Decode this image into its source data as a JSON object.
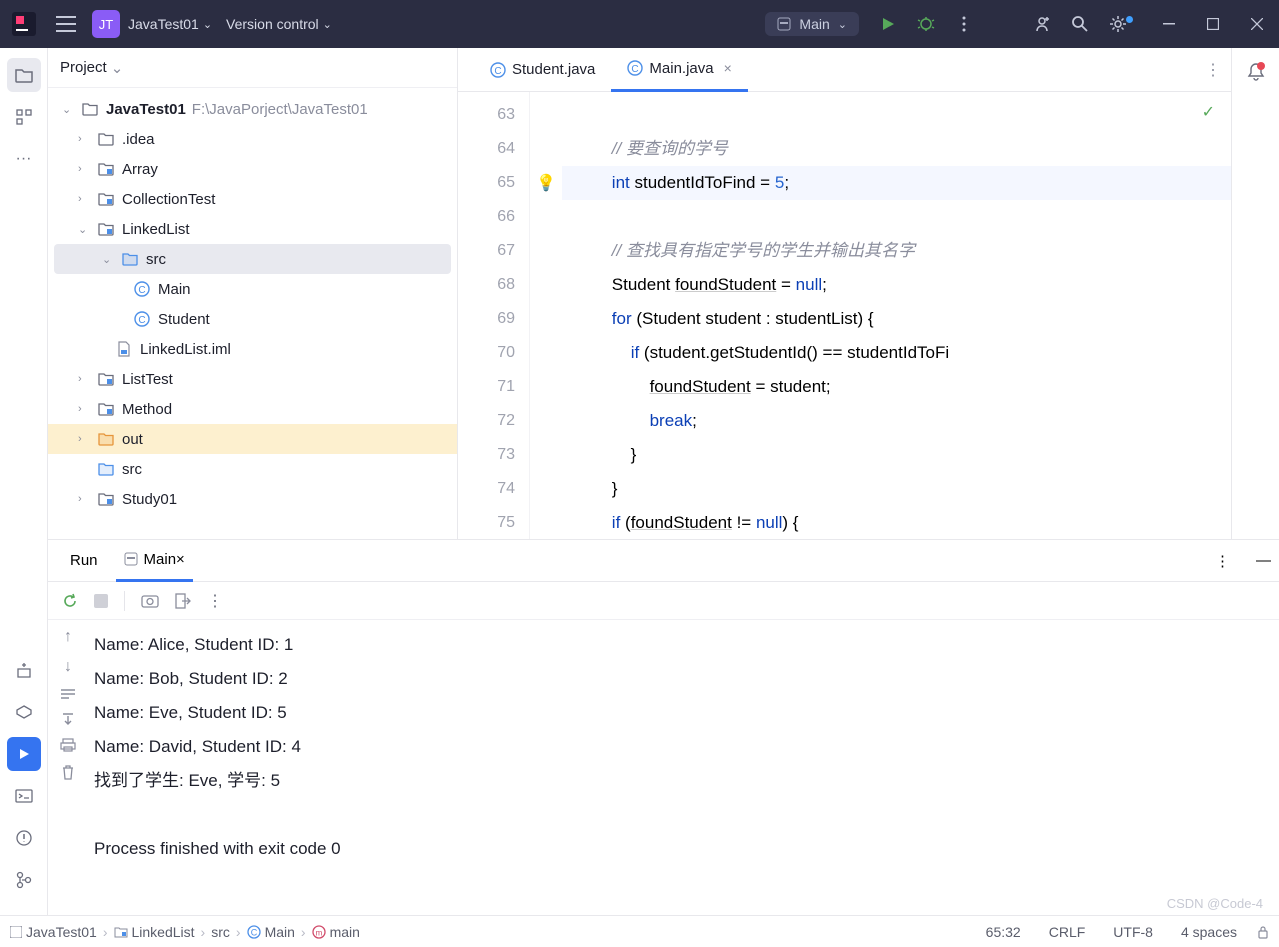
{
  "titlebar": {
    "project_initials": "JT",
    "project_name": "JavaTest01",
    "vcs_label": "Version control",
    "run_config": "Main"
  },
  "project_panel": {
    "title": "Project",
    "tree": [
      {
        "depth": 0,
        "arrow": "v",
        "icon": "folder",
        "label": "JavaTest01",
        "path": "F:\\JavaPorject\\JavaTest01"
      },
      {
        "depth": 1,
        "arrow": ">",
        "icon": "folder",
        "label": ".idea"
      },
      {
        "depth": 1,
        "arrow": ">",
        "icon": "module",
        "label": "Array"
      },
      {
        "depth": 1,
        "arrow": ">",
        "icon": "module",
        "label": "CollectionTest"
      },
      {
        "depth": 1,
        "arrow": "v",
        "icon": "module",
        "label": "LinkedList"
      },
      {
        "depth": 2,
        "arrow": "v",
        "icon": "src-folder",
        "label": "src",
        "selected": true
      },
      {
        "depth": 3,
        "arrow": "",
        "icon": "class",
        "label": "Main"
      },
      {
        "depth": 3,
        "arrow": "",
        "icon": "class",
        "label": "Student"
      },
      {
        "depth": 2,
        "arrow": "",
        "icon": "iml",
        "label": "LinkedList.iml"
      },
      {
        "depth": 1,
        "arrow": ">",
        "icon": "module",
        "label": "ListTest"
      },
      {
        "depth": 1,
        "arrow": ">",
        "icon": "module",
        "label": "Method"
      },
      {
        "depth": 1,
        "arrow": ">",
        "icon": "out-folder",
        "label": "out",
        "highlight": true
      },
      {
        "depth": 1,
        "arrow": "",
        "icon": "src-folder",
        "label": "src"
      },
      {
        "depth": 1,
        "arrow": ">",
        "icon": "module",
        "label": "Study01"
      }
    ]
  },
  "editor": {
    "tabs": [
      {
        "label": "Student.java",
        "active": false
      },
      {
        "label": "Main.java",
        "active": true
      }
    ],
    "line_start": 63,
    "highlighted_line": 65,
    "lines": [
      {
        "n": 63,
        "html": ""
      },
      {
        "n": 64,
        "html": "        <span class='cm'>// 要查询的学号</span>"
      },
      {
        "n": 65,
        "html": "        <span class='kw'>int</span> studentIdToFind = <span class='num'>5</span>;"
      },
      {
        "n": 66,
        "html": ""
      },
      {
        "n": 67,
        "html": "        <span class='cm'>// 查找具有指定学号的学生并输出其名字</span>"
      },
      {
        "n": 68,
        "html": "        Student <span class='uline'>foundStudent</span> = <span class='kw'>null</span>;"
      },
      {
        "n": 69,
        "html": "        <span class='kw'>for</span> (Student student : studentList) {"
      },
      {
        "n": 70,
        "html": "            <span class='kw'>if</span> (student.getStudentId() == studentIdToFi"
      },
      {
        "n": 71,
        "html": "                <span class='uline'>foundStudent</span> = student;"
      },
      {
        "n": 72,
        "html": "                <span class='kw'>break</span>;"
      },
      {
        "n": 73,
        "html": "            }"
      },
      {
        "n": 74,
        "html": "        }"
      },
      {
        "n": 75,
        "html": "        <span class='kw'>if</span> (<span class='uline'>foundStudent</span> != <span class='kw'>null</span>) {"
      }
    ]
  },
  "run_panel": {
    "tab_label": "Run",
    "config_tab": "Main",
    "output": [
      "Name: Alice, Student ID: 1",
      "Name: Bob, Student ID: 2",
      "Name: Eve, Student ID: 5",
      "Name: David, Student ID: 4",
      "找到了学生: Eve, 学号: 5",
      "",
      "Process finished with exit code 0"
    ]
  },
  "statusbar": {
    "breadcrumbs": [
      "JavaTest01",
      "LinkedList",
      "src",
      "Main",
      "main"
    ],
    "cursor": "65:32",
    "line_sep": "CRLF",
    "encoding": "UTF-8",
    "indent": "4 spaces",
    "watermark": "CSDN @Code-4"
  }
}
